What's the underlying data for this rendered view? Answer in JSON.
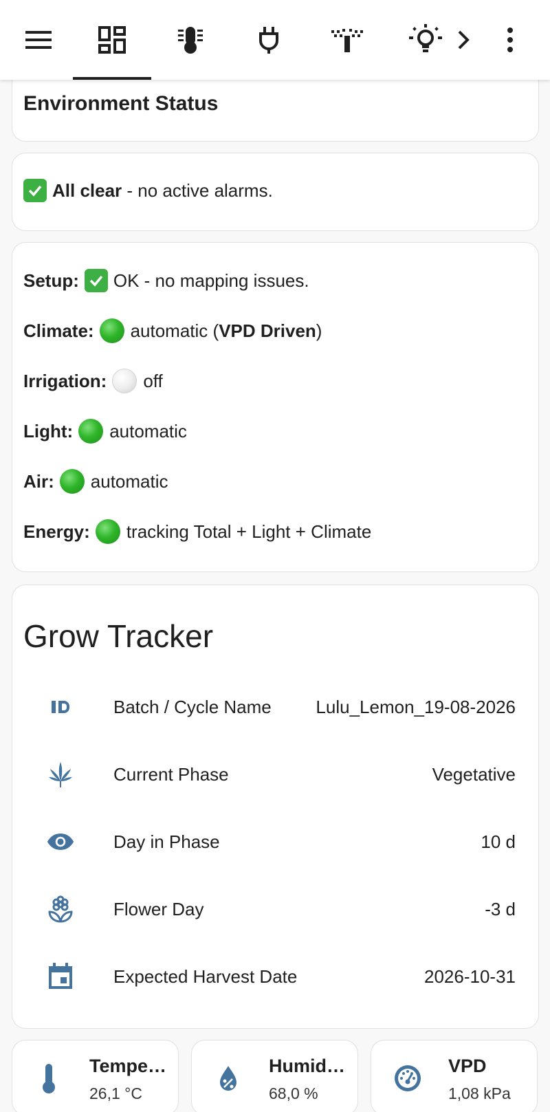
{
  "colors": {
    "accent_icon": "#44739e",
    "status_green": "#2fb52a",
    "card_border": "#e0e0e0",
    "background": "#f8f8f8"
  },
  "toolbar": {
    "icons": [
      "menu-icon",
      "dashboard-icon",
      "thermometer-icon",
      "power-plug-icon",
      "irrigation-icon",
      "lightbulb-icon",
      "chevron-right-icon",
      "more-vertical-icon"
    ],
    "active_tab": "dashboard"
  },
  "environment_status": {
    "title": "Environment Status"
  },
  "alarms": {
    "bold": "All clear",
    "text": " - no active alarms."
  },
  "status_lines": {
    "setup": {
      "label": "Setup:",
      "text": "OK - no mapping issues."
    },
    "climate": {
      "label": "Climate:",
      "text_before": "automatic (",
      "bold": "VPD Driven",
      "text_after": ")"
    },
    "irrigation": {
      "label": "Irrigation:",
      "text": "off"
    },
    "light": {
      "label": "Light:",
      "text": "automatic"
    },
    "air": {
      "label": "Air:",
      "text": "automatic"
    },
    "energy": {
      "label": "Energy:",
      "text": "tracking Total + Light + Climate"
    }
  },
  "grow_tracker": {
    "title": "Grow Tracker",
    "rows": [
      {
        "icon": "id-card-icon",
        "label": "Batch / Cycle Name",
        "value": "Lulu_Lemon_19-08-2026"
      },
      {
        "icon": "cannabis-leaf-icon",
        "label": "Current Phase",
        "value": "Vegetative"
      },
      {
        "icon": "eye-icon",
        "label": "Day in Phase",
        "value": "10 d"
      },
      {
        "icon": "flower-icon",
        "label": "Flower Day",
        "value": "-3 d"
      },
      {
        "icon": "calendar-icon",
        "label": "Expected Harvest Date",
        "value": "2026-10-31"
      }
    ]
  },
  "sensor_tiles": [
    {
      "icon": "thermometer-icon",
      "name": "Tempe…",
      "value": "26,1 °C"
    },
    {
      "icon": "water-percent-icon",
      "name": "Humid…",
      "value": "68,0 %"
    },
    {
      "icon": "gauge-icon",
      "name": "VPD",
      "value": "1,08 kPa"
    }
  ]
}
